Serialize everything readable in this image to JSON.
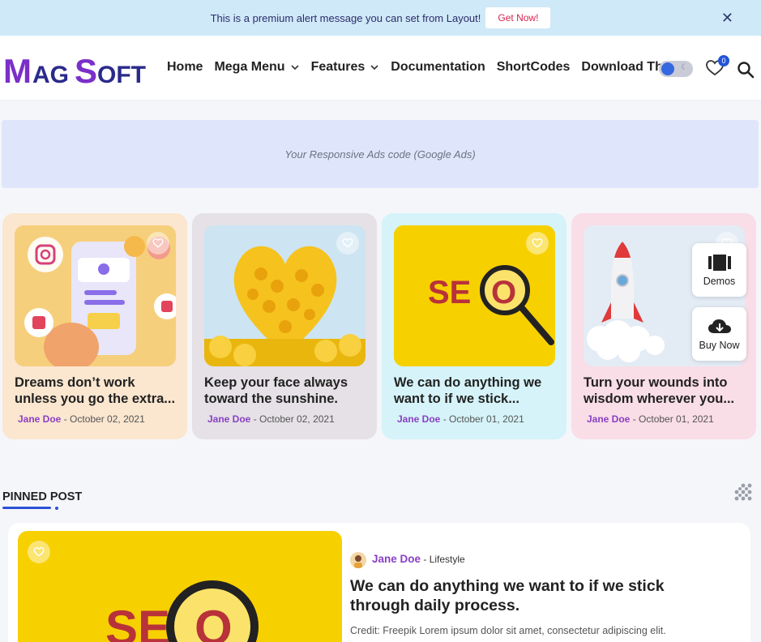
{
  "alert": {
    "message": "This is a premium alert message you can set from Layout!",
    "button": "Get Now!",
    "close": "✕"
  },
  "header": {
    "logo_text": "MagSoft",
    "nav": [
      {
        "label": "Home",
        "has_dropdown": false
      },
      {
        "label": "Mega Menu",
        "has_dropdown": true
      },
      {
        "label": "Features",
        "has_dropdown": true
      },
      {
        "label": "Documentation",
        "has_dropdown": false
      },
      {
        "label": "ShortCodes",
        "has_dropdown": false
      },
      {
        "label": "Download Th",
        "has_dropdown": false
      }
    ],
    "favorites_count": "0",
    "theme_toggle_moon": "☾"
  },
  "ad": {
    "text": "Your Responsive Ads code (Google Ads)"
  },
  "cards": [
    {
      "title": "Dreams don’t work unless you go the extra...",
      "author": "Jane Doe",
      "sep": " - ",
      "date": "October 02, 2021",
      "bg": "#fbe6cf",
      "image": "social-media-phone"
    },
    {
      "title": "Keep your face always toward the sunshine.",
      "author": "Jane Doe",
      "sep": " - ",
      "date": "October 02, 2021",
      "bg": "#e5e1e6",
      "image": "smiley-heart"
    },
    {
      "title": "We can do anything we want to if we stick...",
      "author": "Jane Doe",
      "sep": " - ",
      "date": "October 01, 2021",
      "bg": "#d5f3f8",
      "image": "seo-magnifier"
    },
    {
      "title": "Turn your wounds into wisdom wherever you...",
      "author": "Jane Doe",
      "sep": " - ",
      "date": "October 01, 2021",
      "bg": "#f9dde7",
      "image": "rocket-launch"
    }
  ],
  "side_buttons": {
    "demos": "Demos",
    "buy": "Buy Now"
  },
  "pinned": {
    "section_title": "PINNED POST",
    "author": "Jane Doe",
    "sep": " - ",
    "category": "Lifestyle",
    "title": "We can do anything we want to if we stick through daily process.",
    "excerpt": "Credit: Freepik Lorem ipsum dolor sit amet, consectetur adipiscing elit."
  },
  "colors": {
    "accent": "#2b52d6",
    "author": "#8a3fc4",
    "alert_bg": "#cfe9f8",
    "seo_yellow": "#f7d000"
  }
}
